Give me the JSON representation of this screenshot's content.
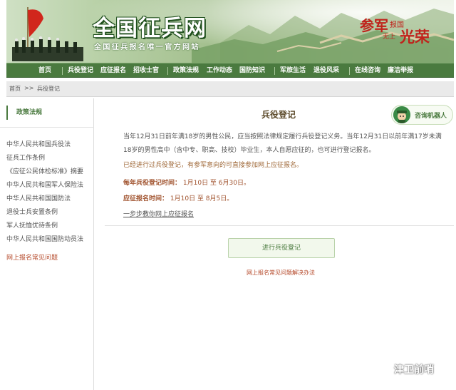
{
  "banner": {
    "title": "全国征兵网",
    "subtitle": "全国征兵报名唯一官方网站",
    "slogan": {
      "main1": "参军",
      "small1": "报国",
      "small2": "无上",
      "main2": "光荣"
    }
  },
  "nav": {
    "items": [
      "首页",
      "兵役登记",
      "应征报名",
      "招收士官",
      "政策法规",
      "工作动态",
      "国防知识",
      "军旅生活",
      "退役风采",
      "在线咨询",
      "廉洁举报"
    ]
  },
  "breadcrumb": {
    "home": "首页",
    "sep": ">>",
    "current": "兵役登记"
  },
  "sidebar": {
    "heading": "政策法规",
    "items": [
      "中华人民共和国兵役法",
      "征兵工作条例",
      "《应征公民体检标准》摘要",
      "中华人民共和国军人保险法",
      "中华人民共和国国防法",
      "退役士兵安置条例",
      "军人抚恤优待条例",
      "中华人民共和国国防动员法"
    ],
    "faq": "网上报名常见问题"
  },
  "main": {
    "title": "兵役登记",
    "robot_label": "咨询机器人",
    "para_line1": "当年12月31日前年满18岁的男性公民，应当按照法律规定履行兵役登记义务。当年12月31日以前年满17岁未满",
    "para_line2": "18岁的男性高中（含中专、职高、技校）毕业生，本人自愿应征的，也可进行登记报名。",
    "note": "已经进行过兵役登记，有参军意向的可直接参加网上应征报名。",
    "reg_time_label": "每年兵役登记时间：",
    "reg_time_value": "1月10日 至 6月30日。",
    "apply_time_label": "应征报名时间：",
    "apply_time_value": "1月10日 至 8月5日。",
    "step_link": "一步步教你网上应征报名",
    "register_button": "进行兵役登记",
    "faq_link": "网上报名常见问题解决办法"
  },
  "watermark": "津卫前哨",
  "colors": {
    "nav": "#4a7a3f",
    "accent_red": "#c0221b",
    "link_brown": "#a0522d"
  }
}
